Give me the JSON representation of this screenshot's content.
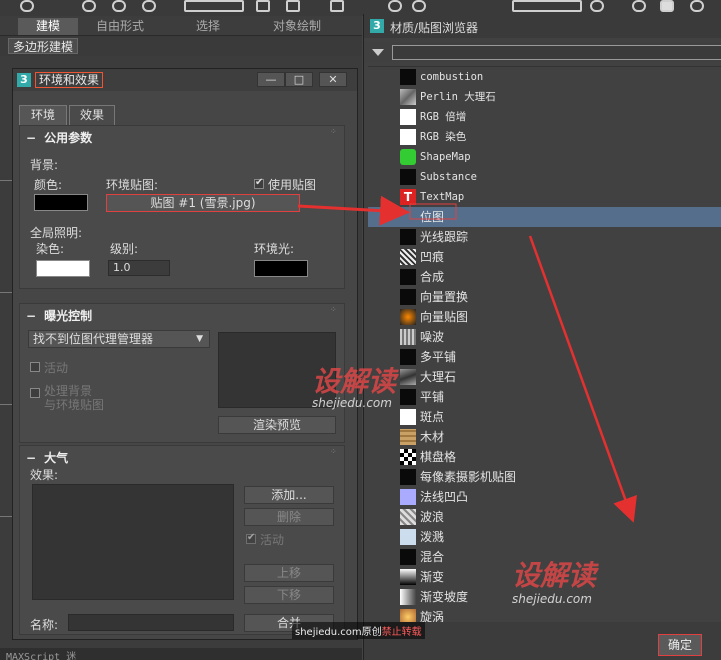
{
  "ribbon": {
    "tabs": [
      "建模",
      "自由形式",
      "选择",
      "对象绘制"
    ],
    "sub": "多边形建模"
  },
  "env": {
    "title": "环境和效果",
    "win_buttons": [
      "—",
      "□",
      "✕"
    ],
    "tabs": [
      "环境",
      "效果"
    ],
    "common": {
      "header": "公用参数",
      "bg_label": "背景:",
      "color_label": "颜色:",
      "map_label": "环境贴图:",
      "use_map_label": "使用贴图",
      "map_button": "贴图 #1 (雪景.jpg)",
      "gl_label": "全局照明:",
      "tint_label": "染色:",
      "level_label": "级别:",
      "level_value": "1.0",
      "ambient_label": "环境光:"
    },
    "exposure": {
      "header": "曝光控制",
      "dropdown": "找不到位图代理管理器",
      "active_label": "活动",
      "process_bg_label": "处理背景\n与环境贴图",
      "render_preview": "渲染预览"
    },
    "atmos": {
      "header": "大气",
      "effects_label": "效果:",
      "add": "添加...",
      "delete": "删除",
      "active": "活动",
      "up": "上移",
      "down": "下移",
      "name_label": "名称:",
      "merge": "合并"
    }
  },
  "mat": {
    "title": "材质/贴图浏览器",
    "items": [
      {
        "label": "combustion",
        "icon": "black",
        "mono": true
      },
      {
        "label": "Perlin 大理石",
        "icon": "perlin",
        "mono": true
      },
      {
        "label": "RGB 倍增",
        "icon": "white",
        "mono": true
      },
      {
        "label": "RGB 染色",
        "icon": "white",
        "mono": true
      },
      {
        "label": "ShapeMap",
        "icon": "shape",
        "mono": true
      },
      {
        "label": "Substance",
        "icon": "black",
        "mono": true
      },
      {
        "label": "TextMap",
        "icon": "text",
        "mono": true
      },
      {
        "label": "位图",
        "icon": "none",
        "selected": true
      },
      {
        "label": "光线跟踪",
        "icon": "black"
      },
      {
        "label": "凹痕",
        "icon": "dent"
      },
      {
        "label": "合成",
        "icon": "black"
      },
      {
        "label": "向量置换",
        "icon": "black"
      },
      {
        "label": "向量贴图",
        "icon": "vecmap"
      },
      {
        "label": "噪波",
        "icon": "noise"
      },
      {
        "label": "多平铺",
        "icon": "black"
      },
      {
        "label": "大理石",
        "icon": "marble"
      },
      {
        "label": "平铺",
        "icon": "black"
      },
      {
        "label": "斑点",
        "icon": "white"
      },
      {
        "label": "木材",
        "icon": "wood"
      },
      {
        "label": "棋盘格",
        "icon": "checker"
      },
      {
        "label": "每像素摄影机贴图",
        "icon": "black"
      },
      {
        "label": "法线凹凸",
        "icon": "normal"
      },
      {
        "label": "波浪",
        "icon": "wave"
      },
      {
        "label": "泼溅",
        "icon": "splat"
      },
      {
        "label": "混合",
        "icon": "black"
      },
      {
        "label": "渐变",
        "icon": "gradient"
      },
      {
        "label": "渐变坡度",
        "icon": "ramp"
      },
      {
        "label": "旋涡",
        "icon": "swirl"
      }
    ],
    "ok": "确定"
  },
  "watermark": {
    "brand": "设解读",
    "site": "shejiedu.com",
    "footer_site": "shejiedu.com原创",
    "footer_warn": "禁止转载"
  },
  "status": {
    "script": "MAXScript 迷"
  },
  "colors": {
    "accent_red": "#e04040",
    "selection": "#546e8c",
    "arrow": "#e53030"
  }
}
